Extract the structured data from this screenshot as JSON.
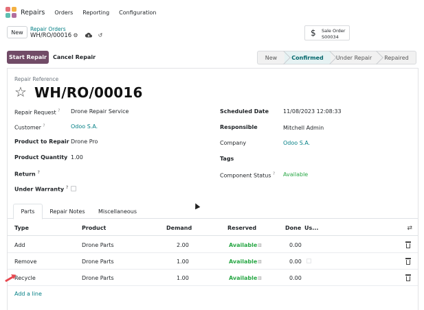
{
  "navbar": {
    "app_name": "Repairs",
    "menu": [
      "Orders",
      "Reporting",
      "Configuration"
    ]
  },
  "control_panel": {
    "new_label": "New",
    "breadcrumb": "Repair Orders",
    "record": "WH/RO/00016",
    "smart_button": {
      "title": "Sale Order",
      "value": "S00034",
      "icon": "dollar-icon"
    }
  },
  "actions": {
    "primary": "Start Repair",
    "secondary": "Cancel Repair"
  },
  "statusbar": {
    "stages": [
      "New",
      "Confirmed",
      "Under Repair",
      "Repaired"
    ],
    "active": "Confirmed"
  },
  "form": {
    "reference_label": "Repair Reference",
    "reference": "WH/RO/00016",
    "left": {
      "repair_request": {
        "label": "Repair Request",
        "help": "?",
        "value": "Drone Repair Service"
      },
      "customer": {
        "label": "Customer",
        "help": "?",
        "value": "Odoo S.A."
      },
      "product": {
        "label": "Product to Repair",
        "value": "Drone Pro"
      },
      "quantity": {
        "label": "Product Quantity",
        "value": "1.00"
      },
      "return": {
        "label": "Return",
        "help": "?"
      },
      "warranty": {
        "label": "Under Warranty",
        "help": "?"
      }
    },
    "right": {
      "scheduled": {
        "label": "Scheduled Date",
        "value": "11/08/2023 12:08:33"
      },
      "responsible": {
        "label": "Responsible",
        "value": "Mitchell Admin"
      },
      "company": {
        "label": "Company",
        "value": "Odoo S.A."
      },
      "tags": {
        "label": "Tags"
      },
      "component_status": {
        "label": "Component Status",
        "help": "?",
        "value": "Available"
      }
    }
  },
  "tabs": [
    "Parts",
    "Repair Notes",
    "Miscellaneous"
  ],
  "parts_table": {
    "headers": [
      "Type",
      "Product",
      "Demand",
      "Reserved",
      "Done",
      "Us..."
    ],
    "rows": [
      {
        "type": "Add",
        "product": "Drone Parts",
        "demand": "2.00",
        "reserved": "Available",
        "done": "0.00"
      },
      {
        "type": "Remove",
        "product": "Drone Parts",
        "demand": "1.00",
        "reserved": "Available",
        "done": "0.00"
      },
      {
        "type": "Recycle",
        "product": "Drone Parts",
        "demand": "1.00",
        "reserved": "Available",
        "done": "0.00"
      }
    ],
    "add_line": "Add a line"
  },
  "colors": {
    "primary": "#714b67",
    "link": "#017e84",
    "available": "#28a745"
  }
}
